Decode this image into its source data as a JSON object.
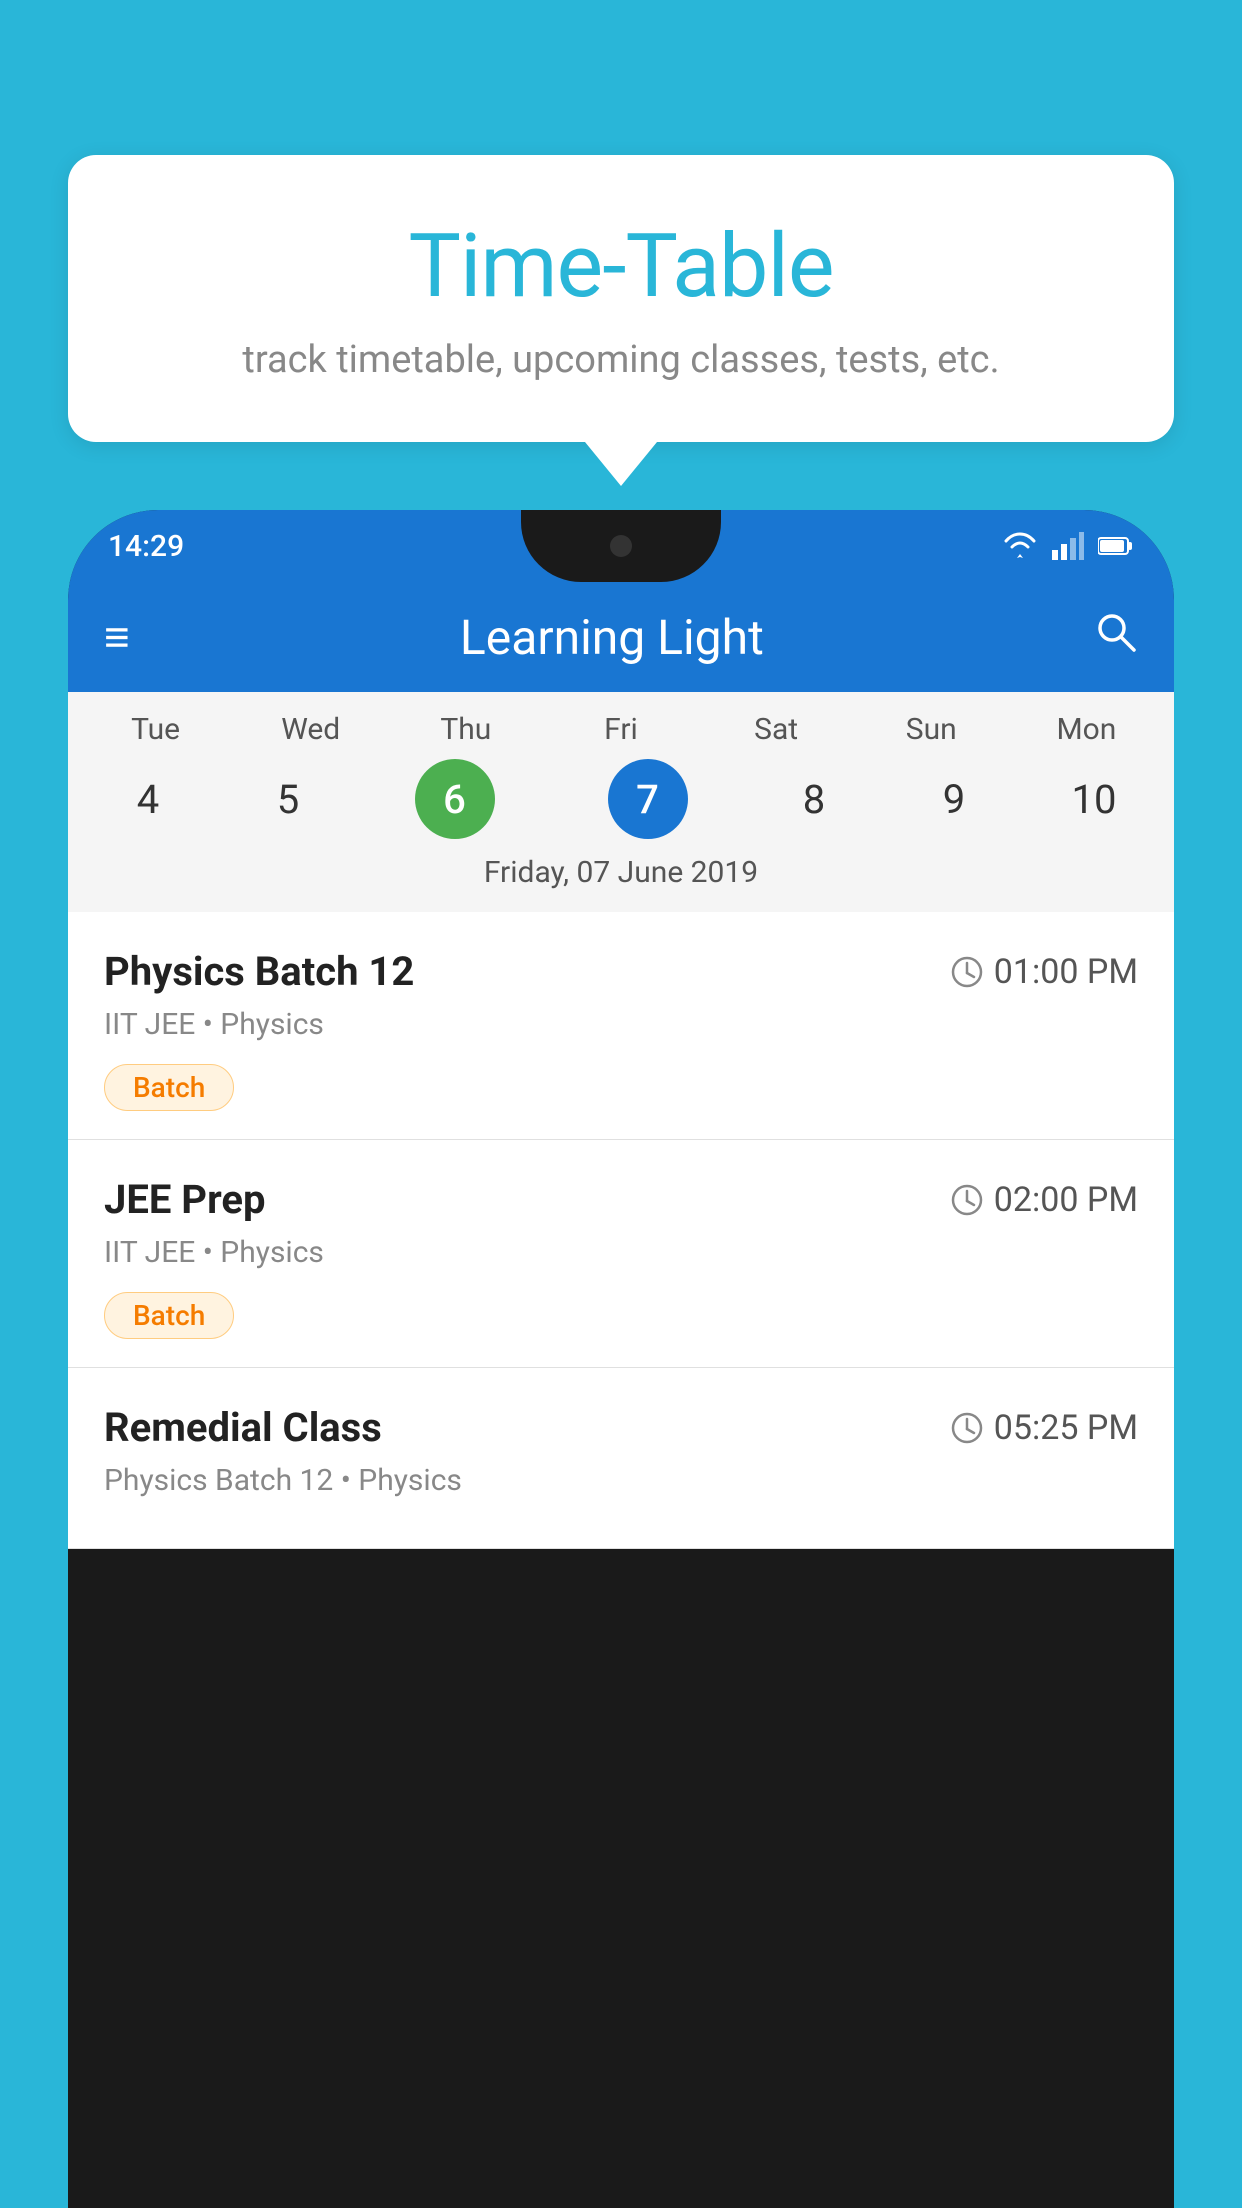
{
  "background_color": "#29b6d8",
  "bubble": {
    "title": "Time-Table",
    "subtitle": "track timetable, upcoming classes, tests, etc."
  },
  "status_bar": {
    "time": "14:29",
    "icons": [
      "wifi",
      "signal",
      "battery"
    ]
  },
  "app_bar": {
    "title": "Learning Light",
    "menu_icon": "≡",
    "search_icon": "🔍"
  },
  "calendar": {
    "days": [
      {
        "label": "Tue",
        "num": "4"
      },
      {
        "label": "Wed",
        "num": "5"
      },
      {
        "label": "Thu",
        "num": "6",
        "state": "today"
      },
      {
        "label": "Fri",
        "num": "7",
        "state": "selected"
      },
      {
        "label": "Sat",
        "num": "8"
      },
      {
        "label": "Sun",
        "num": "9"
      },
      {
        "label": "Mon",
        "num": "10"
      }
    ],
    "selected_date": "Friday, 07 June 2019"
  },
  "classes": [
    {
      "title": "Physics Batch 12",
      "time": "01:00 PM",
      "meta": "IIT JEE • Physics",
      "tag": "Batch"
    },
    {
      "title": "JEE Prep",
      "time": "02:00 PM",
      "meta": "IIT JEE • Physics",
      "tag": "Batch"
    },
    {
      "title": "Remedial Class",
      "time": "05:25 PM",
      "meta": "Physics Batch 12 • Physics",
      "tag": ""
    }
  ]
}
